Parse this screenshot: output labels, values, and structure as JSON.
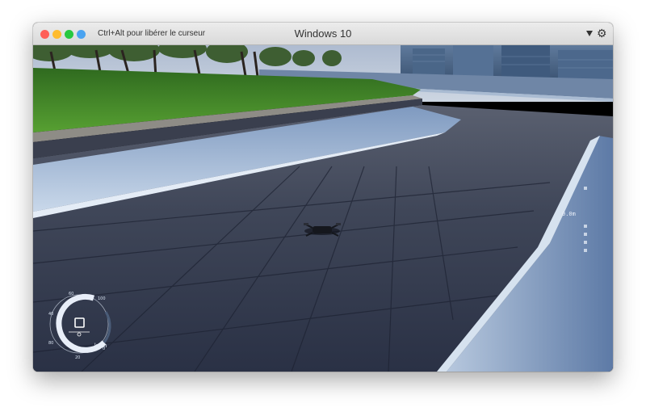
{
  "window": {
    "title": "Windows 10",
    "cursor_hint": "Ctrl+Alt pour libérer le curseur",
    "menu_icon": "chevron-down-icon",
    "settings_icon": "gear-icon"
  },
  "hud": {
    "altitude_readout": "0.0m",
    "speed_unit": "km/h",
    "speed_ticks": [
      "60",
      "100",
      "40",
      "80",
      "0",
      "20"
    ]
  },
  "colors": {
    "traffic_red": "#fe5f57",
    "traffic_yellow": "#febc2e",
    "traffic_green": "#28c840",
    "traffic_blue": "#4aa3f0",
    "hud_arc": "#e8eef8"
  }
}
